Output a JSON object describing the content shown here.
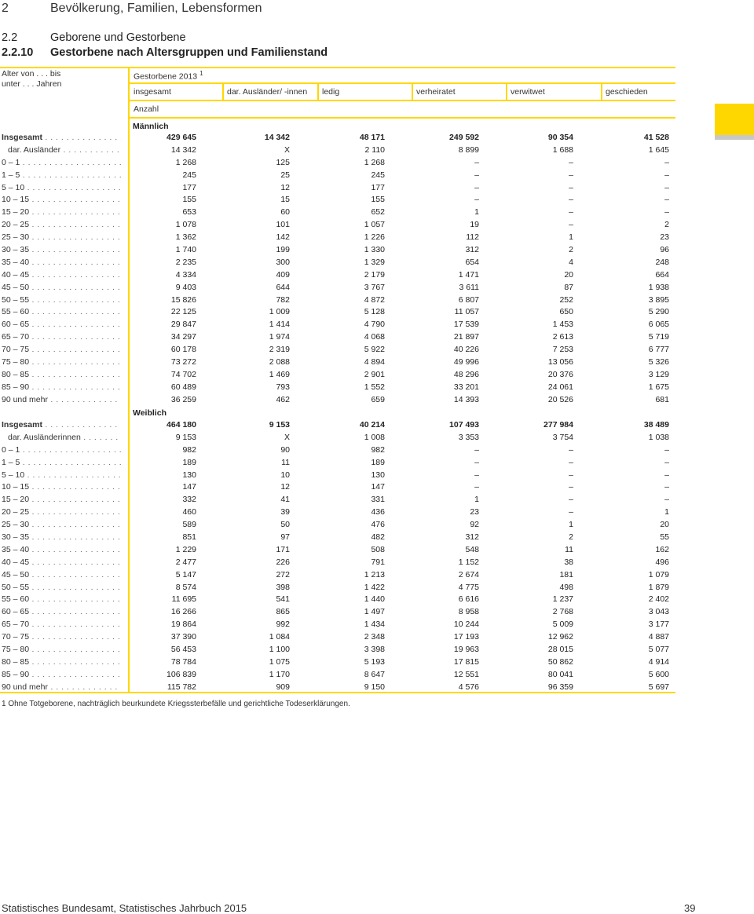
{
  "chapter": {
    "number": "2",
    "title": "Bevölkerung, Familien, Lebensformen"
  },
  "section": {
    "number": "2.2",
    "title": "Geborene und Gestorbene"
  },
  "subsection": {
    "number": "2.2.10",
    "title": "Gestorbene nach Altersgruppen und Familienstand"
  },
  "table": {
    "stub_header_1": "Alter von . . . bis",
    "stub_header_2": "unter . . . Jahren",
    "span_header": "Gestorbene 2013",
    "span_header_note": "1",
    "columns": [
      "insgesamt",
      "dar. Ausländer/ -innen",
      "ledig",
      "verheiratet",
      "verwitwet",
      "geschieden"
    ],
    "unit": "Anzahl",
    "groups": [
      {
        "label": "Männlich",
        "rows": [
          {
            "label": "Insgesamt",
            "dots": " . . . . . . . . . . . . . . . . . . . . . .",
            "values": [
              "429 645",
              "14 342",
              "48 171",
              "249 592",
              "90 354",
              "41 528"
            ]
          },
          {
            "label": "dar. Ausländer",
            "dots": " . . . . . . . . . . . . . . . . . .",
            "values": [
              "14 342",
              "X",
              "2 110",
              "8 899",
              "1 688",
              "1 645"
            ]
          },
          {
            "label": "0 – 1",
            "dots": " . . . . . . . . . . . . . . . . . . . . . . . . . .",
            "values": [
              "1 268",
              "125",
              "1 268",
              "–",
              "–",
              "–"
            ]
          },
          {
            "label": "1 – 5",
            "dots": " . . . . . . . . . . . . . . . . . . . . . . . . . .",
            "values": [
              "245",
              "25",
              "245",
              "–",
              "–",
              "–"
            ]
          },
          {
            "label": "5 – 10",
            "dots": " . . . . . . . . . . . . . . . . . . . . . . . . . .",
            "values": [
              "177",
              "12",
              "177",
              "–",
              "–",
              "–"
            ]
          },
          {
            "label": "10 – 15",
            "dots": " . . . . . . . . . . . . . . . . . . . . . . . . .",
            "values": [
              "155",
              "15",
              "155",
              "–",
              "–",
              "–"
            ]
          },
          {
            "label": "15 – 20",
            "dots": " . . . . . . . . . . . . . . . . . . . . . . . . .",
            "values": [
              "653",
              "60",
              "652",
              "1",
              "–",
              "–"
            ]
          },
          {
            "label": "20 – 25",
            "dots": " . . . . . . . . . . . . . . . . . . . . . . . . .",
            "values": [
              "1 078",
              "101",
              "1 057",
              "19",
              "–",
              "2"
            ]
          },
          {
            "label": "25 – 30",
            "dots": " . . . . . . . . . . . . . . . . . . . . . . . . .",
            "values": [
              "1 362",
              "142",
              "1 226",
              "112",
              "1",
              "23"
            ]
          },
          {
            "label": "30 – 35",
            "dots": " . . . . . . . . . . . . . . . . . . . . . . . . .",
            "values": [
              "1 740",
              "199",
              "1 330",
              "312",
              "2",
              "96"
            ]
          },
          {
            "label": "35 – 40",
            "dots": " . . . . . . . . . . . . . . . . . . . . . . . . .",
            "values": [
              "2 235",
              "300",
              "1 329",
              "654",
              "4",
              "248"
            ]
          },
          {
            "label": "40 – 45",
            "dots": " . . . . . . . . . . . . . . . . . . . . . . . . .",
            "values": [
              "4 334",
              "409",
              "2 179",
              "1 471",
              "20",
              "664"
            ]
          },
          {
            "label": "45 – 50",
            "dots": " . . . . . . . . . . . . . . . . . . . . . . . . .",
            "values": [
              "9 403",
              "644",
              "3 767",
              "3 611",
              "87",
              "1 938"
            ]
          },
          {
            "label": "50 – 55",
            "dots": " . . . . . . . . . . . . . . . . . . . . . . . . .",
            "values": [
              "15 826",
              "782",
              "4 872",
              "6 807",
              "252",
              "3 895"
            ]
          },
          {
            "label": "55 – 60",
            "dots": " . . . . . . . . . . . . . . . . . . . . . . . . .",
            "values": [
              "22 125",
              "1 009",
              "5 128",
              "11 057",
              "650",
              "5 290"
            ]
          },
          {
            "label": "60 – 65",
            "dots": " . . . . . . . . . . . . . . . . . . . . . . . . .",
            "values": [
              "29 847",
              "1 414",
              "4 790",
              "17 539",
              "1 453",
              "6 065"
            ]
          },
          {
            "label": "65 – 70",
            "dots": " . . . . . . . . . . . . . . . . . . . . . . . . .",
            "values": [
              "34 297",
              "1 974",
              "4 068",
              "21 897",
              "2 613",
              "5 719"
            ]
          },
          {
            "label": "70 – 75",
            "dots": " . . . . . . . . . . . . . . . . . . . . . . . . .",
            "values": [
              "60 178",
              "2 319",
              "5 922",
              "40 226",
              "7 253",
              "6 777"
            ]
          },
          {
            "label": "75 – 80",
            "dots": " . . . . . . . . . . . . . . . . . . . . . . . . .",
            "values": [
              "73 272",
              "2 088",
              "4 894",
              "49 996",
              "13 056",
              "5 326"
            ]
          },
          {
            "label": "80 – 85",
            "dots": " . . . . . . . . . . . . . . . . . . . . . . . . .",
            "values": [
              "74 702",
              "1 469",
              "2 901",
              "48 296",
              "20 376",
              "3 129"
            ]
          },
          {
            "label": "85 – 90",
            "dots": " . . . . . . . . . . . . . . . . . . . . . . . . .",
            "values": [
              "60 489",
              "793",
              "1 552",
              "33 201",
              "24 061",
              "1 675"
            ]
          },
          {
            "label": "90 und mehr",
            "dots": " . . . . . . . . . . . . . . . . . . . .",
            "values": [
              "36 259",
              "462",
              "659",
              "14 393",
              "20 526",
              "681"
            ]
          }
        ]
      },
      {
        "label": "Weiblich",
        "rows": [
          {
            "label": "Insgesamt",
            "dots": " . . . . . . . . . . . . . . . . . . . . . .",
            "values": [
              "464 180",
              "9 153",
              "40 214",
              "107 493",
              "277 984",
              "38 489"
            ]
          },
          {
            "label": "dar. Ausländerinnen",
            "dots": " . . . . . . . . . . . . . .",
            "values": [
              "9 153",
              "X",
              "1 008",
              "3 353",
              "3 754",
              "1 038"
            ]
          },
          {
            "label": "0 – 1",
            "dots": " . . . . . . . . . . . . . . . . . . . . . . . . . .",
            "values": [
              "982",
              "90",
              "982",
              "–",
              "–",
              "–"
            ]
          },
          {
            "label": "1 – 5",
            "dots": " . . . . . . . . . . . . . . . . . . . . . . . . . .",
            "values": [
              "189",
              "11",
              "189",
              "–",
              "–",
              "–"
            ]
          },
          {
            "label": "5 – 10",
            "dots": " . . . . . . . . . . . . . . . . . . . . . . . . . .",
            "values": [
              "130",
              "10",
              "130",
              "–",
              "–",
              "–"
            ]
          },
          {
            "label": "10 – 15",
            "dots": " . . . . . . . . . . . . . . . . . . . . . . . . .",
            "values": [
              "147",
              "12",
              "147",
              "–",
              "–",
              "–"
            ]
          },
          {
            "label": "15 – 20",
            "dots": " . . . . . . . . . . . . . . . . . . . . . . . . .",
            "values": [
              "332",
              "41",
              "331",
              "1",
              "–",
              "–"
            ]
          },
          {
            "label": "20 – 25",
            "dots": " . . . . . . . . . . . . . . . . . . . . . . . . .",
            "values": [
              "460",
              "39",
              "436",
              "23",
              "–",
              "1"
            ]
          },
          {
            "label": "25 – 30",
            "dots": " . . . . . . . . . . . . . . . . . . . . . . . . .",
            "values": [
              "589",
              "50",
              "476",
              "92",
              "1",
              "20"
            ]
          },
          {
            "label": "30 – 35",
            "dots": " . . . . . . . . . . . . . . . . . . . . . . . . .",
            "values": [
              "851",
              "97",
              "482",
              "312",
              "2",
              "55"
            ]
          },
          {
            "label": "35 – 40",
            "dots": " . . . . . . . . . . . . . . . . . . . . . . . . .",
            "values": [
              "1 229",
              "171",
              "508",
              "548",
              "11",
              "162"
            ]
          },
          {
            "label": "40 – 45",
            "dots": " . . . . . . . . . . . . . . . . . . . . . . . . .",
            "values": [
              "2 477",
              "226",
              "791",
              "1 152",
              "38",
              "496"
            ]
          },
          {
            "label": "45 – 50",
            "dots": " . . . . . . . . . . . . . . . . . . . . . . . . .",
            "values": [
              "5 147",
              "272",
              "1 213",
              "2 674",
              "181",
              "1 079"
            ]
          },
          {
            "label": "50 – 55",
            "dots": " . . . . . . . . . . . . . . . . . . . . . . . . .",
            "values": [
              "8 574",
              "398",
              "1 422",
              "4 775",
              "498",
              "1 879"
            ]
          },
          {
            "label": "55 – 60",
            "dots": " . . . . . . . . . . . . . . . . . . . . . . . . .",
            "values": [
              "11 695",
              "541",
              "1 440",
              "6 616",
              "1 237",
              "2 402"
            ]
          },
          {
            "label": "60 – 65",
            "dots": " . . . . . . . . . . . . . . . . . . . . . . . . .",
            "values": [
              "16 266",
              "865",
              "1 497",
              "8 958",
              "2 768",
              "3 043"
            ]
          },
          {
            "label": "65 – 70",
            "dots": " . . . . . . . . . . . . . . . . . . . . . . . . .",
            "values": [
              "19 864",
              "992",
              "1 434",
              "10 244",
              "5 009",
              "3 177"
            ]
          },
          {
            "label": "70 – 75",
            "dots": " . . . . . . . . . . . . . . . . . . . . . . . . .",
            "values": [
              "37 390",
              "1 084",
              "2 348",
              "17 193",
              "12 962",
              "4 887"
            ]
          },
          {
            "label": "75 – 80",
            "dots": " . . . . . . . . . . . . . . . . . . . . . . . . .",
            "values": [
              "56 453",
              "1 100",
              "3 398",
              "19 963",
              "28 015",
              "5 077"
            ]
          },
          {
            "label": "80 – 85",
            "dots": " . . . . . . . . . . . . . . . . . . . . . . . . .",
            "values": [
              "78 784",
              "1 075",
              "5 193",
              "17 815",
              "50 862",
              "4 914"
            ]
          },
          {
            "label": "85 – 90",
            "dots": " . . . . . . . . . . . . . . . . . . . . . . . . .",
            "values": [
              "106 839",
              "1 170",
              "8 647",
              "12 551",
              "80 041",
              "5 600"
            ]
          },
          {
            "label": "90 und mehr",
            "dots": " . . . . . . . . . . . . . . . . . . . .",
            "values": [
              "115 782",
              "909",
              "9 150",
              "4 576",
              "96 359",
              "5 697"
            ]
          }
        ]
      }
    ]
  },
  "footnote": "1  Ohne Totgeborene, nachträglich beurkundete Kriegssterbefälle und gerichtliche Todeserklärungen.",
  "footer": {
    "source": "Statistisches Bundesamt, Statistisches Jahrbuch 2015",
    "page": "39"
  },
  "colors": {
    "accent": "#ffd700",
    "tab_gray": "#c8c8c8"
  }
}
